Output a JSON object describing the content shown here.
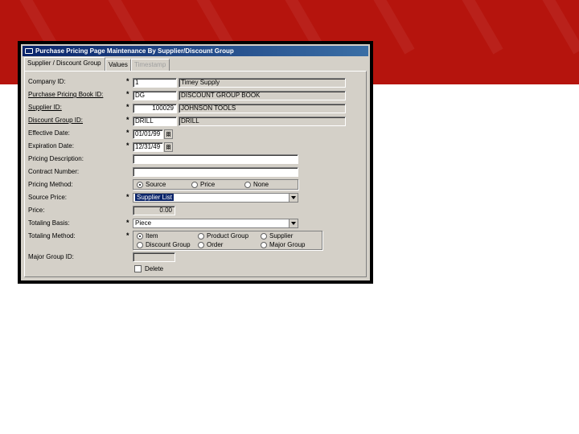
{
  "window": {
    "title": "Purchase Pricing Page Maintenance By Supplier/Discount Group"
  },
  "tabs": [
    {
      "label": "Supplier / Discount Group"
    },
    {
      "label": "Values"
    },
    {
      "label": "Timestamp"
    }
  ],
  "required_mark": "*",
  "fields": {
    "company_id": {
      "label": "Company ID:",
      "value": "1",
      "desc": "Timey Supply"
    },
    "pricing_book_id": {
      "label": "Purchase Pricing Book ID:",
      "value": "DG",
      "desc": "DISCOUNT GROUP BOOK"
    },
    "supplier_id": {
      "label": "Supplier ID:",
      "value": "100029",
      "desc": "JOHNSON TOOLS"
    },
    "discount_group_id": {
      "label": "Discount Group ID:",
      "value": "DRILL",
      "desc": "DRILL"
    },
    "effective_date": {
      "label": "Effective Date:",
      "value": "01/01/99"
    },
    "expiration_date": {
      "label": "Expiration Date:",
      "value": "12/31/49"
    },
    "pricing_description": {
      "label": "Pricing Description:",
      "value": ""
    },
    "contract_number": {
      "label": "Contract Number:",
      "value": ""
    },
    "pricing_method": {
      "label": "Pricing Method:",
      "options": [
        "Source",
        "Price",
        "None"
      ],
      "selected": "Source"
    },
    "source_price": {
      "label": "Source Price:",
      "value": "Supplier List"
    },
    "price": {
      "label": "Price:",
      "value": "0.00"
    },
    "totaling_basis": {
      "label": "Totaling Basis:",
      "value": "Piece"
    },
    "totaling_method": {
      "label": "Totaling Method:",
      "options": [
        "Item",
        "Product Group",
        "Supplier",
        "Discount Group",
        "Order",
        "Major Group"
      ],
      "selected": "Item"
    },
    "major_group_id": {
      "label": "Major Group ID:",
      "value": ""
    }
  },
  "delete_label": "Delete",
  "colors": {
    "banner": "#b5140d",
    "titlebar": "#0a246a",
    "face": "#d4d0c8"
  }
}
